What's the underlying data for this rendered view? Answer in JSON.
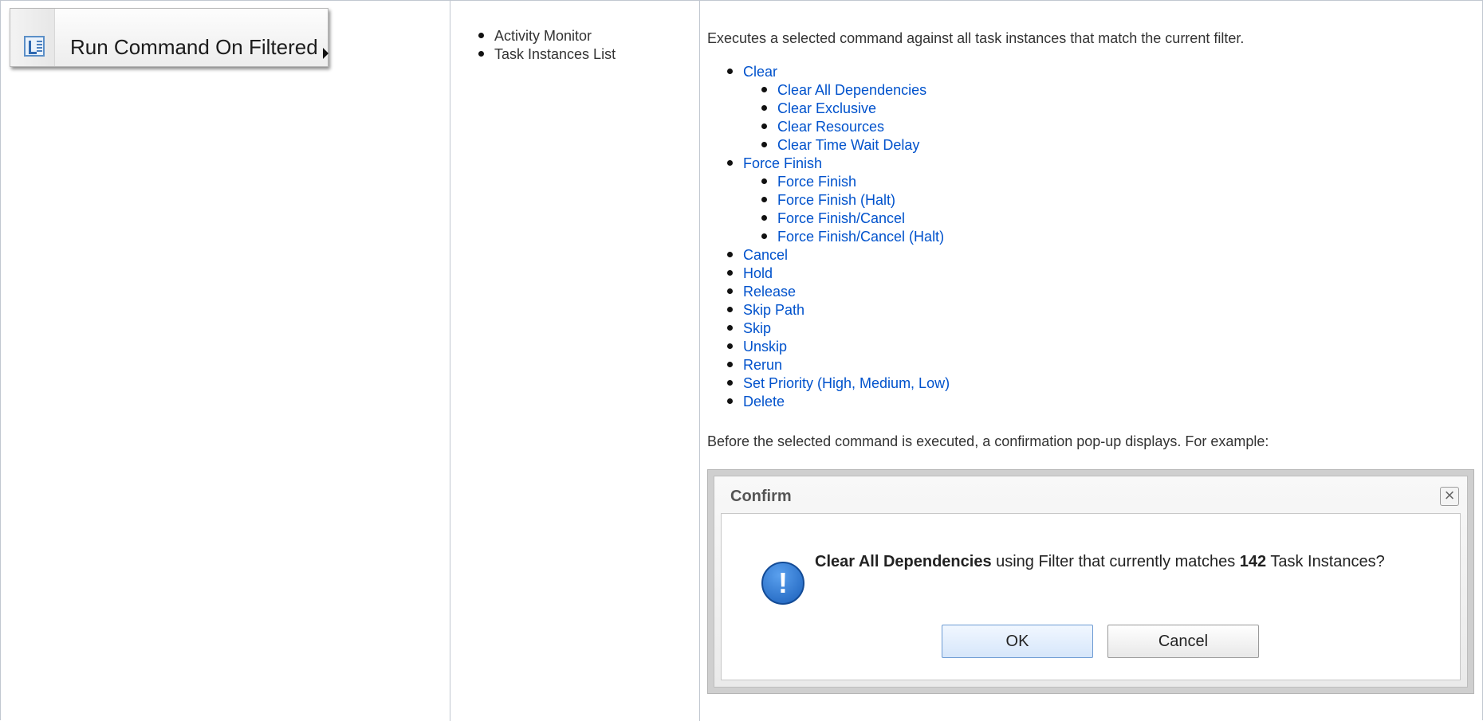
{
  "menu_item": {
    "label": "Run Command On Filtered",
    "icon": "run-command-icon"
  },
  "where": [
    "Activity Monitor",
    "Task Instances List"
  ],
  "description": "Executes a selected command against all task instances that match the current filter.",
  "commands": [
    {
      "label": "Clear",
      "children": [
        "Clear All Dependencies",
        "Clear Exclusive",
        "Clear Resources",
        "Clear Time Wait Delay"
      ]
    },
    {
      "label": "Force Finish",
      "children": [
        "Force Finish",
        "Force Finish (Halt)",
        "Force Finish/Cancel",
        "Force Finish/Cancel (Halt)"
      ]
    },
    {
      "label": "Cancel"
    },
    {
      "label": "Hold"
    },
    {
      "label": "Release"
    },
    {
      "label": "Skip Path"
    },
    {
      "label": "Skip"
    },
    {
      "label": "Unskip"
    },
    {
      "label": "Rerun"
    },
    {
      "label": "Set Priority (High, Medium, Low)"
    },
    {
      "label": "Delete"
    }
  ],
  "note": "Before the selected command is executed, a confirmation pop-up displays. For example:",
  "dialog": {
    "title": "Confirm",
    "close": "×",
    "icon": "!",
    "message_command": "Clear All Dependencies",
    "message_middle": " using Filter that currently matches ",
    "message_count": "142",
    "message_end": " Task Instances?",
    "ok_label": "OK",
    "cancel_label": "Cancel"
  },
  "colors": {
    "link": "#0052cc",
    "border": "#c1c7d0"
  }
}
